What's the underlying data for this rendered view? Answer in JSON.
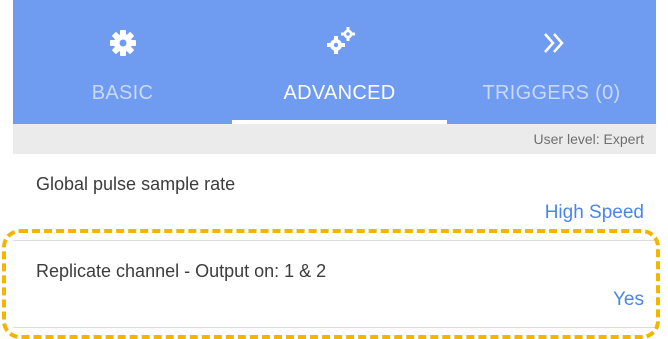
{
  "tabs": [
    {
      "label": "BASIC",
      "icon": "gear-icon",
      "active": false
    },
    {
      "label": "ADVANCED",
      "icon": "gears-icon",
      "active": true
    },
    {
      "label": "TRIGGERS (0)",
      "icon": "double-chevron-right-icon",
      "active": false
    }
  ],
  "user_level": "User level: Expert",
  "settings": [
    {
      "title": "Global pulse sample rate",
      "value": "High Speed"
    },
    {
      "title": "Replicate channel - Output on: 1 & 2",
      "value": "Yes"
    }
  ],
  "colors": {
    "header": "#6f9bf1",
    "value": "#4a86e8",
    "highlight": "#f4b400"
  }
}
